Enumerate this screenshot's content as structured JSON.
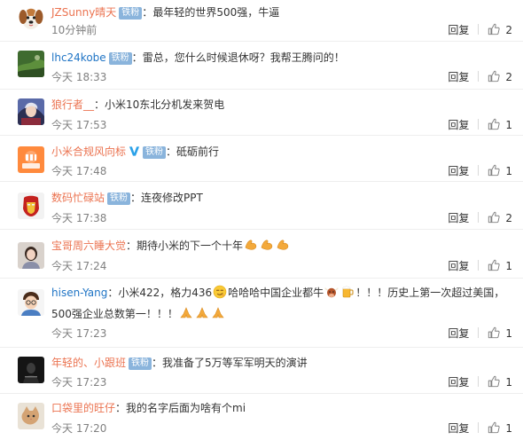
{
  "comments": [
    {
      "avatar_icon": "beagle-dog-avatar",
      "user": "JZSunny晴天",
      "badge": "铁粉",
      "text": "最年轻的世界500强，牛逼",
      "time": "10分钟前",
      "reply_label": "回复",
      "likes": "2"
    },
    {
      "avatar_icon": "green-field-avatar",
      "user": "lhc24kobe",
      "badge": "铁粉",
      "text": "雷总，您什么时候退休呀？我帮王腾问的！",
      "time": "今天 18:33",
      "reply_label": "回复",
      "likes": "2"
    },
    {
      "avatar_icon": "anime-character-avatar",
      "user": "狼行者__",
      "text": "小米10东北分机发来贺电",
      "time": "今天 17:53",
      "reply_label": "回复",
      "likes": "1"
    },
    {
      "avatar_icon": "orange-logo-avatar",
      "user": "小米合规风向标",
      "badge": "铁粉",
      "verified_icon": "verified-v-icon",
      "text": "砥砺前行",
      "time": "今天 17:48",
      "reply_label": "回复",
      "likes": "1"
    },
    {
      "avatar_icon": "iron-man-avatar",
      "user": "数码忙碌站",
      "badge": "铁粉",
      "text": "连夜修改PPT",
      "time": "今天 17:38",
      "reply_label": "回复",
      "likes": "2"
    },
    {
      "avatar_icon": "girl-photo-avatar",
      "user": "宝哥周六睡大觉",
      "text": "期待小米的下一个十年",
      "text_emoji_icons": [
        "flexed-biceps-icon",
        "flexed-biceps-icon",
        "flexed-biceps-icon"
      ],
      "time": "今天 17:24",
      "reply_label": "回复",
      "likes": "1"
    },
    {
      "avatar_icon": "cartoon-boy-avatar",
      "user": "hisen-Yang",
      "text_part1": "小米422，格力436",
      "emoji1_icon": "smirk-face-icon",
      "text_part2": "哈哈哈中国企业都牛",
      "emoji2_icon": "bull-face-icon",
      "emoji3_icon": "beer-mug-icon",
      "text_part3": "！！！历史上第一次超过美国，500强企业总数第一！！！",
      "emoji_tail_icons": [
        "folded-hands-icon",
        "folded-hands-icon",
        "folded-hands-icon"
      ],
      "time": "今天 17:23",
      "reply_label": "回复",
      "likes": "1"
    },
    {
      "avatar_icon": "dark-photo-avatar",
      "user": "年轻的、小跟班",
      "badge": "铁粉",
      "text": "我准备了5万等军军明天的演讲",
      "time": "今天 17:23",
      "reply_label": "回复",
      "likes": "1"
    },
    {
      "avatar_icon": "cat-photo-avatar",
      "user": "口袋里的旺仔",
      "text": "我的名字后面为啥有个mi",
      "time": "今天 17:20",
      "reply_label": "回复",
      "likes": "1"
    }
  ],
  "colors": {
    "username": "#eb7350",
    "badge_bg": "#8ab4dc",
    "verified": "#2aa1e8",
    "meta_text": "#808080",
    "divider": "#eeeeee"
  }
}
